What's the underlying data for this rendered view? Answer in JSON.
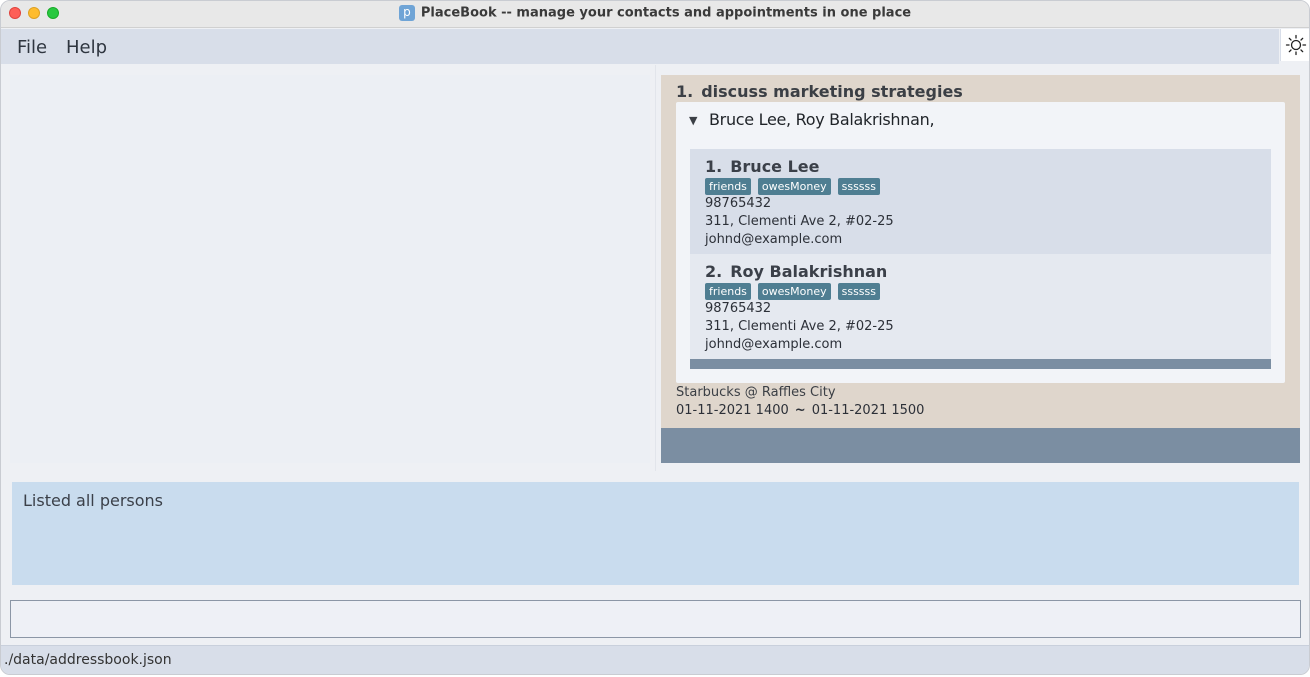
{
  "window": {
    "title": "PlaceBook -- manage your contacts and appointments in one place",
    "app_icon_letter": "p"
  },
  "menu": {
    "file": "File",
    "help": "Help",
    "theme_toggle_icon": "sun-icon"
  },
  "appointment": {
    "index": "1.",
    "title": "discuss marketing strategies",
    "attendees_summary": "Bruce Lee, Roy Balakrishnan,",
    "persons": [
      {
        "index": "1.",
        "name": "Bruce Lee",
        "tags": [
          "friends",
          "owesMoney",
          "ssssss"
        ],
        "phone": "98765432",
        "address": "311, Clementi Ave 2, #02-25",
        "email": "johnd@example.com"
      },
      {
        "index": "2.",
        "name": "Roy Balakrishnan",
        "tags": [
          "friends",
          "owesMoney",
          "ssssss"
        ],
        "phone": "98765432",
        "address": "311, Clementi Ave 2, #02-25",
        "email": "johnd@example.com"
      }
    ],
    "location": "Starbucks @ Raffles City",
    "start": "01-11-2021 1400",
    "separator": "~",
    "end": "01-11-2021 1500"
  },
  "result": {
    "message": "Listed all persons"
  },
  "command": {
    "value": "",
    "placeholder": ""
  },
  "status": {
    "file_path": "./data/addressbook.json"
  },
  "colors": {
    "menu_bg": "#d8dee9",
    "appointment_card": "#dfd6cc",
    "tag": "#4f7e92",
    "result_bg": "#c9dcee"
  }
}
